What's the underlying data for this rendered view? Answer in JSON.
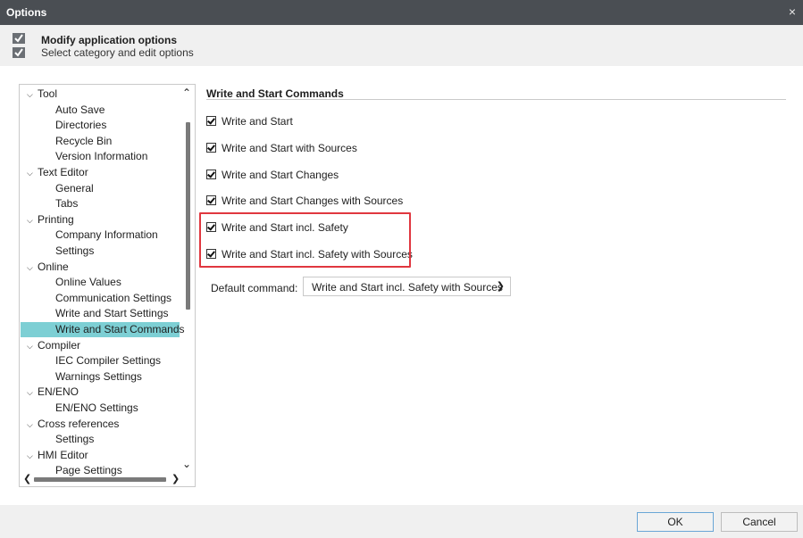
{
  "window": {
    "title": "Options",
    "close_glyph": "×"
  },
  "header": {
    "title": "Modify application options",
    "subtitle": "Select category and edit options",
    "icon": "checklist-icon"
  },
  "tree": {
    "items": [
      {
        "label": "Tool",
        "type": "category"
      },
      {
        "label": "Auto Save",
        "type": "child"
      },
      {
        "label": "Directories",
        "type": "child"
      },
      {
        "label": "Recycle Bin",
        "type": "child"
      },
      {
        "label": "Version Information",
        "type": "child"
      },
      {
        "label": "Text Editor",
        "type": "category"
      },
      {
        "label": "General",
        "type": "child"
      },
      {
        "label": "Tabs",
        "type": "child"
      },
      {
        "label": "Printing",
        "type": "category"
      },
      {
        "label": "Company Information",
        "type": "child"
      },
      {
        "label": "Settings",
        "type": "child"
      },
      {
        "label": "Online",
        "type": "category"
      },
      {
        "label": "Online Values",
        "type": "child"
      },
      {
        "label": "Communication Settings",
        "type": "child"
      },
      {
        "label": "Write and Start Settings",
        "type": "child"
      },
      {
        "label": "Write and Start Commands",
        "type": "child",
        "selected": true
      },
      {
        "label": "Compiler",
        "type": "category"
      },
      {
        "label": "IEC Compiler Settings",
        "type": "child"
      },
      {
        "label": "Warnings Settings",
        "type": "child"
      },
      {
        "label": "EN/ENO",
        "type": "category"
      },
      {
        "label": "EN/ENO Settings",
        "type": "child"
      },
      {
        "label": "Cross references",
        "type": "category"
      },
      {
        "label": "Settings",
        "type": "child"
      },
      {
        "label": "HMI Editor",
        "type": "category"
      },
      {
        "label": "Page Settings",
        "type": "child"
      }
    ]
  },
  "section": {
    "title": "Write and Start Commands"
  },
  "checkboxes": [
    {
      "label": "Write and Start",
      "checked": true
    },
    {
      "label": "Write and Start with Sources",
      "checked": true
    },
    {
      "label": "Write and Start Changes",
      "checked": true
    },
    {
      "label": "Write and Start Changes with Sources",
      "checked": true
    },
    {
      "label": "Write and Start incl. Safety",
      "checked": true
    },
    {
      "label": "Write and Start incl. Safety with Sources",
      "checked": true
    }
  ],
  "default_command": {
    "label": "Default command:",
    "value": "Write and Start incl. Safety with Sources"
  },
  "buttons": {
    "ok": "OK",
    "cancel": "Cancel"
  },
  "colors": {
    "selection": "#7dcfd4",
    "highlight_border": "#e0373f",
    "titlebar": "#4a4e53"
  }
}
